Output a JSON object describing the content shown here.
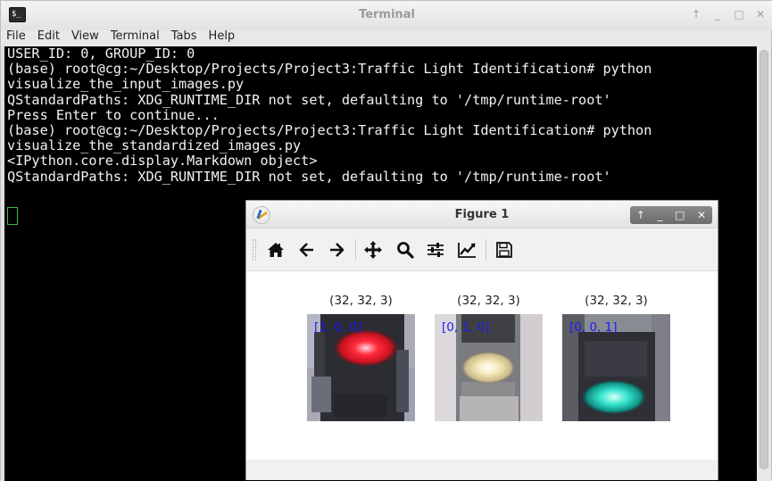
{
  "terminal": {
    "title": "Terminal",
    "app_icon_text": "$_",
    "controls": [
      "↑",
      "_",
      "□",
      "✕"
    ],
    "menu": [
      "File",
      "Edit",
      "View",
      "Terminal",
      "Tabs",
      "Help"
    ],
    "lines": [
      "USER_ID: 0, GROUP_ID: 0",
      "(base) root@cg:~/Desktop/Projects/Project3:Traffic Light Identification# python",
      "visualize_the_input_images.py",
      "QStandardPaths: XDG_RUNTIME_DIR not set, defaulting to '/tmp/runtime-root'",
      "Press Enter to continue...",
      "(base) root@cg:~/Desktop/Projects/Project3:Traffic Light Identification# python",
      "visualize_the_standardized_images.py",
      "<IPython.core.display.Markdown object>",
      "QStandardPaths: XDG_RUNTIME_DIR not set, defaulting to '/tmp/runtime-root'"
    ]
  },
  "figure": {
    "title": "Figure 1",
    "controls": [
      "↑",
      "_",
      "□",
      "✕"
    ],
    "toolbar": {
      "home": "home-icon",
      "back": "arrow-left-icon",
      "forward": "arrow-right-icon",
      "pan": "move-icon",
      "zoom": "zoom-icon",
      "configure": "sliders-icon",
      "edit_axes": "chart-line-icon",
      "save": "save-icon"
    },
    "subplots": [
      {
        "title": "(32, 32, 3)",
        "label": "[1, 0, 0]",
        "light_color": "#ff2a3c"
      },
      {
        "title": "(32, 32, 3)",
        "label": "[0, 1, 0]",
        "light_color": "#f5e6b8"
      },
      {
        "title": "(32, 32, 3)",
        "label": "[0, 0, 1]",
        "light_color": "#39e6cf"
      }
    ]
  }
}
